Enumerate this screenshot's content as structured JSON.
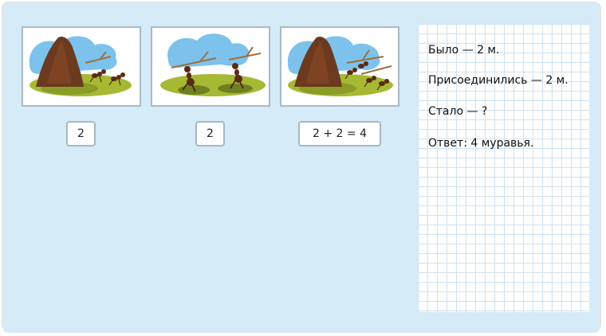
{
  "cards": [
    {
      "icon": "anthill-with-two-ants-image"
    },
    {
      "icon": "two-ants-carrying-twigs-image"
    },
    {
      "icon": "anthill-with-four-ants-image"
    }
  ],
  "answers": [
    "2",
    "2",
    "2 + 2 = 4"
  ],
  "notebook": {
    "lines": [
      "Было — 2 м.",
      "Присоединились — 2 м.",
      "Стало — ?",
      "Ответ: 4 муравья."
    ]
  },
  "colors": {
    "panel": "#d5ebf7",
    "card_border": "#a9b9c6",
    "grid": "#cfe1ef"
  }
}
